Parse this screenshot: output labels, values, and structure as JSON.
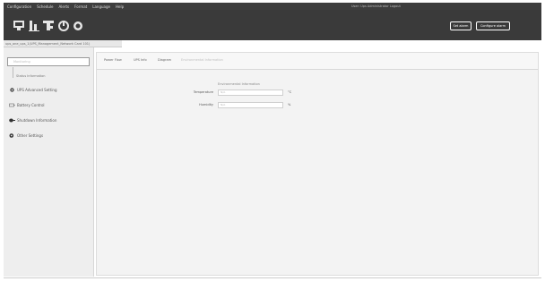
{
  "menubar": {
    "items": [
      "Configuration",
      "Schedule",
      "Alerts",
      "Format",
      "Language",
      "Help"
    ],
    "user_info": "User: Ups   Administrator   Logout"
  },
  "toolbar": {
    "icons": [
      "monitor-icon",
      "chart-icon",
      "settings-icon",
      "shutdown-icon",
      "refresh-icon"
    ],
    "buttons": {
      "left": "Set alarm",
      "right": "Configure alarm"
    }
  },
  "breadcrumb": "ups_one_ups_1(UPS_Management_Network Card 101)",
  "sidebar": {
    "selected": "Monitoring",
    "sub_item": "Status Information",
    "items": [
      {
        "label": "UPS Advanced Setting",
        "icon": "gear-icon"
      },
      {
        "label": "Battery Control",
        "icon": "battery-icon"
      },
      {
        "label": "Shutdown Information",
        "icon": "shutdown-icon"
      },
      {
        "label": "Other Settings",
        "icon": "info-icon"
      }
    ]
  },
  "tabs": [
    "Power Flow",
    "UPS Info",
    "Diagram",
    "Environmental Information"
  ],
  "section_title": "Environmental Information",
  "fields": [
    {
      "label": "Temperature",
      "value": "N/A",
      "unit": "°C"
    },
    {
      "label": "Humidity",
      "value": "N/A",
      "unit": "%"
    }
  ],
  "colors": {
    "menubar_bg": "#3e3e3e",
    "toolbar_bg": "#3a3a3a",
    "sidebar_bg": "#eeeeee",
    "main_bg": "#f3f3f3"
  }
}
